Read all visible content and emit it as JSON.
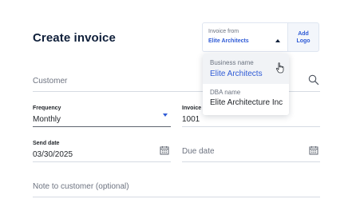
{
  "header": {
    "title": "Create invoice"
  },
  "invoice_from": {
    "label": "Invoice from",
    "value": "Elite Architects",
    "options": [
      {
        "label": "Business name",
        "value": "Elite Architects",
        "selected": true
      },
      {
        "label": "DBA name",
        "value": "Elite Architecture Inc",
        "selected": false
      }
    ]
  },
  "add_logo": {
    "label_line1": "Add",
    "label_line2": "Logo"
  },
  "customer": {
    "placeholder": "Customer"
  },
  "frequency": {
    "label": "Frequency",
    "value": "Monthly"
  },
  "invoice_number": {
    "label": "Invoice ..",
    "value": "1001"
  },
  "send_date": {
    "label": "Send date",
    "value": "03/30/2025"
  },
  "due_date": {
    "placeholder": "Due date"
  },
  "note": {
    "placeholder": "Note to customer (optional)"
  },
  "colors": {
    "accent": "#2f5bd6",
    "title": "#0f1f3a",
    "field_line": "#d6dbe3"
  }
}
